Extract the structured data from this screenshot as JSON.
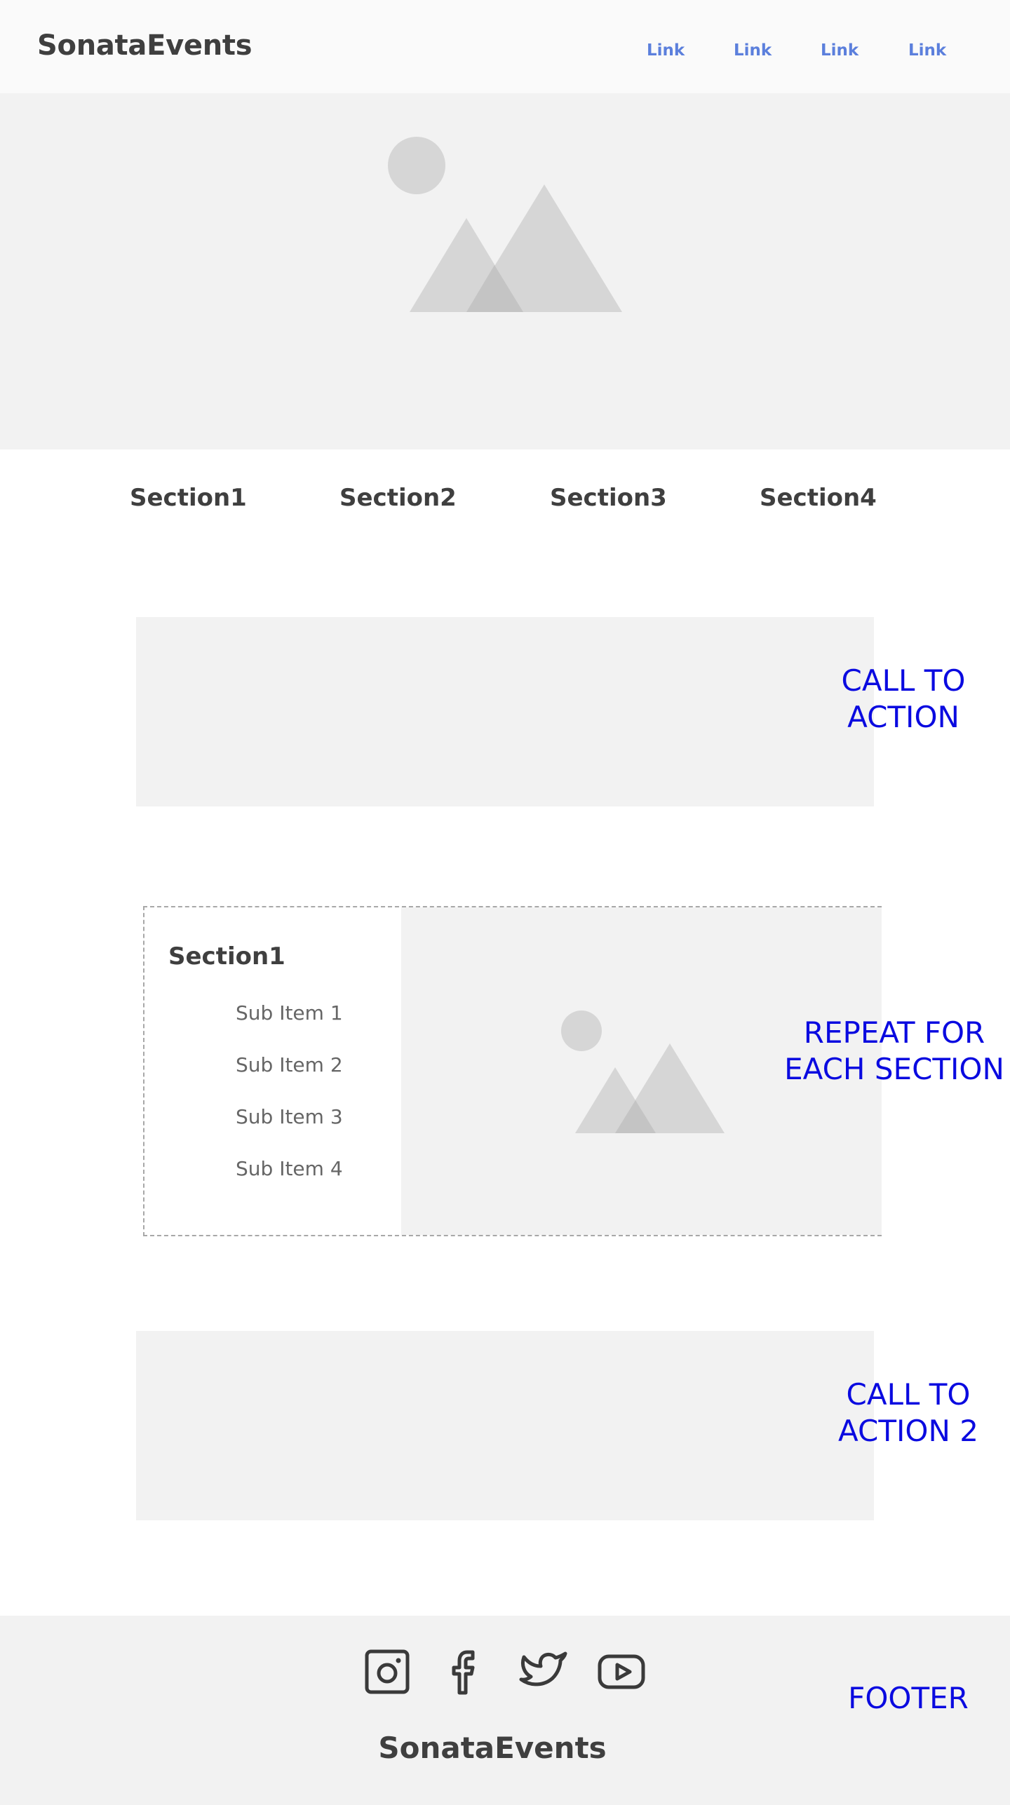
{
  "header": {
    "brand": "SonataEvents",
    "links": [
      "Link",
      "Link",
      "Link",
      "Link"
    ]
  },
  "hero": {
    "image_icon": "image-placeholder-icon"
  },
  "section_nav": [
    "Section1",
    "Section2",
    "Section3",
    "Section4"
  ],
  "cta": {
    "note_1_line1": "CALL TO",
    "note_1_line2": "ACTION",
    "note_2_line1": "CALL TO",
    "note_2_line2": "ACTION 2"
  },
  "repeat_section": {
    "title": "Section1",
    "items": [
      "Sub Item 1",
      "Sub Item 2",
      "Sub Item 3",
      "Sub Item 4"
    ],
    "note_line1": "REPEAT FOR",
    "note_line2": "EACH SECTION"
  },
  "footer": {
    "social_icons": [
      "instagram-icon",
      "facebook-icon",
      "twitter-icon",
      "youtube-icon"
    ],
    "brand": "SonataEvents",
    "note": "FOOTER"
  },
  "colors": {
    "link": "#5b7fdc",
    "annotation": "#0a0ae0",
    "placeholder_bg": "#f2f2f2",
    "header_bg": "#fafafa",
    "text_dark": "#3f3f3f"
  }
}
